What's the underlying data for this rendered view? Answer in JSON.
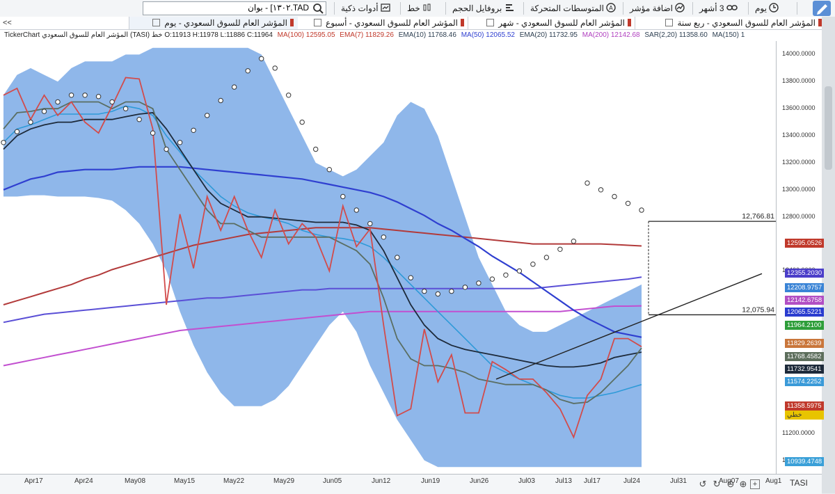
{
  "toolbar": {
    "period": "يوم",
    "range": "3 أشهر",
    "add_indicator": "اضافة مؤشر",
    "moving_averages": "المتوسطات المتحركة",
    "volume_profile": "بروفايل الحجم",
    "line": "خط",
    "smart_tools": "أدوات ذكية",
    "search_value": "TAD.١٣٠٢] - بوان"
  },
  "tabs": [
    {
      "label": "المؤشر العام للسوق السعودي - ربع سنة"
    },
    {
      "label": "المؤشر العام للسوق السعودي - شهر"
    },
    {
      "label": "المؤشر العام للسوق السعودي - أسبوع"
    },
    {
      "label": "المؤشر العام للسوق السعودي - يوم"
    }
  ],
  "tabs_scroll": "<<",
  "infobar": {
    "title": "TickerChart المؤشر العام للسوق السعودي (TASI) خط O:11913 H:11978 L:11886 C:11964",
    "items": [
      {
        "text": "MA(100) 12595.05",
        "color": "#c0392b"
      },
      {
        "text": "EMA(7) 11829.26",
        "color": "#c0392b"
      },
      {
        "text": "EMA(10) 11768.46",
        "color": "#2c3e50"
      },
      {
        "text": "MA(50) 12065.52",
        "color": "#2f3fd0"
      },
      {
        "text": "EMA(20) 11732.95",
        "color": "#2c3e50"
      },
      {
        "text": "MA(200) 12142.68",
        "color": "#b03fbf"
      },
      {
        "text": "SAR(2,20) 11358.60",
        "color": "#2c3e50"
      },
      {
        "text": "MA(150) 1",
        "color": "#2c3e50"
      }
    ]
  },
  "colors": {
    "band": "#1f6fd6",
    "price": "#d24b4b",
    "ema10": "#5a6e62",
    "ema7": "#c97575",
    "ema20": "#1d2a3a",
    "ma50": "#2f3fd0",
    "ma100": "#b23a3a",
    "ma150": "#5a4fd6",
    "ma200": "#c24fd0",
    "fast": "#2e9ad8"
  },
  "chart_data": {
    "type": "line",
    "instrument": "TASI",
    "x_labels": [
      "Apr17",
      "Apr24",
      "May08",
      "May15",
      "May22",
      "May29",
      "Jun05",
      "Jun12",
      "Jun19",
      "Jun26",
      "Jul03",
      "Jul13",
      "Jul17",
      "Jul24",
      "Jul31",
      "Aug07",
      "Aug1"
    ],
    "y_ticks": [
      14000,
      13800,
      13600,
      13400,
      13200,
      13000,
      12800,
      12600,
      12400,
      12200,
      12000,
      11800,
      11600,
      11400,
      11200,
      11000
    ],
    "y_tick_labels": [
      "14000.0000",
      "13800.0000",
      "13600.0000",
      "13400.0000",
      "13200.0000",
      "13000.0000",
      "12800.0000",
      "",
      "12400.0000",
      "",
      "",
      "",
      "",
      "",
      "11200.0000",
      "11000.0000"
    ],
    "ylim": [
      10900,
      14100
    ],
    "annotations": [
      {
        "text": "12,766.81",
        "value": 12766.81
      },
      {
        "text": "12,075.94",
        "value": 12075.94
      }
    ],
    "price_badges": [
      {
        "text": "12595.0526",
        "color": "#c0392b"
      },
      {
        "text": "12355.2030",
        "color": "#4b3ec9"
      },
      {
        "text": "12208.9757",
        "color": "#3a84d6"
      },
      {
        "text": "12142.6758",
        "color": "#b24fc4"
      },
      {
        "text": "12065.5221",
        "color": "#2a3ccf"
      },
      {
        "text": "11964.2100",
        "color": "#2e9e3a"
      },
      {
        "text": "11829.2639",
        "color": "#c9763b"
      },
      {
        "text": "11768.4582",
        "color": "#5d6e5c"
      },
      {
        "text": "11732.9541",
        "color": "#1d2a3a"
      },
      {
        "text": "11574.2252",
        "color": "#3a9ad8"
      },
      {
        "text": "11358.5975",
        "color": "#c0392b"
      },
      {
        "text": "10939.4748",
        "color": "#3aa0d8"
      }
    ],
    "price_badges_partial": "خطي",
    "series": [
      {
        "key": "price",
        "values": [
          13700,
          13750,
          13520,
          13700,
          13550,
          13650,
          13500,
          13420,
          13620,
          13830,
          13820,
          13450,
          12150,
          12820,
          12420,
          12950,
          12700,
          12950,
          12700,
          12500,
          12850,
          12600,
          12750,
          12650,
          12400,
          12880,
          12580,
          12710,
          12000,
          11330,
          11380,
          11970,
          11580,
          11780,
          11350,
          11350,
          11730,
          11670,
          11600,
          11600,
          11500,
          11380,
          11170,
          11480,
          11600,
          11900,
          11900,
          11840
        ]
      },
      {
        "key": "ema10",
        "values": [
          13450,
          13570,
          13580,
          13600,
          13600,
          13650,
          13650,
          13650,
          13600,
          13650,
          13650,
          13600,
          13300,
          13150,
          13000,
          12850,
          12750,
          12750,
          12700,
          12650,
          12650,
          12650,
          12650,
          12650,
          12650,
          12600,
          12550,
          12450,
          12200,
          11900,
          11750,
          11700,
          11700,
          11680,
          11650,
          11600,
          11580,
          11560,
          11560,
          11560,
          11520,
          11450,
          11420,
          11430,
          11500,
          11600,
          11700,
          11830
        ]
      },
      {
        "key": "ema20",
        "values": [
          13300,
          13400,
          13450,
          13480,
          13500,
          13500,
          13520,
          13520,
          13520,
          13540,
          13560,
          13570,
          13450,
          13300,
          13150,
          13000,
          12900,
          12850,
          12800,
          12800,
          12790,
          12780,
          12770,
          12760,
          12760,
          12760,
          12740,
          12700,
          12550,
          12350,
          12150,
          12000,
          11900,
          11850,
          11820,
          11800,
          11780,
          11760,
          11740,
          11720,
          11700,
          11690,
          11690,
          11700,
          11720,
          11760,
          11780,
          11800
        ]
      },
      {
        "key": "fast",
        "values": [
          13350,
          13450,
          13480,
          13520,
          13560,
          13560,
          13560,
          13560,
          13580,
          13620,
          13600,
          13550,
          13400,
          13280,
          13150,
          13050,
          12950,
          12880,
          12830,
          12800,
          12780,
          12750,
          12700,
          12670,
          12650,
          12640,
          12620,
          12580,
          12500,
          12400,
          12300,
          12200,
          12100,
          12000,
          11900,
          11800,
          11700,
          11650,
          11600,
          11560,
          11520,
          11480,
          11460,
          11460,
          11480,
          11500,
          11530,
          11560
        ]
      },
      {
        "key": "ma50",
        "values": [
          13000,
          13040,
          13080,
          13100,
          13130,
          13140,
          13150,
          13150,
          13150,
          13160,
          13170,
          13170,
          13170,
          13170,
          13160,
          13150,
          13140,
          13130,
          13120,
          13110,
          13100,
          13090,
          13080,
          13060,
          13040,
          13020,
          13000,
          12980,
          12950,
          12910,
          12860,
          12810,
          12750,
          12700,
          12640,
          12580,
          12510,
          12450,
          12390,
          12320,
          12250,
          12180,
          12110,
          12050,
          12000,
          11950,
          11930,
          11910
        ]
      },
      {
        "key": "ma100",
        "values": [
          12150,
          12180,
          12210,
          12240,
          12270,
          12300,
          12340,
          12370,
          12410,
          12440,
          12470,
          12500,
          12530,
          12560,
          12590,
          12610,
          12630,
          12650,
          12670,
          12680,
          12690,
          12700,
          12710,
          12720,
          12720,
          12720,
          12720,
          12720,
          12710,
          12700,
          12690,
          12680,
          12670,
          12660,
          12650,
          12640,
          12630,
          12620,
          12610,
          12600,
          12600,
          12600,
          12600,
          12600,
          12600,
          12595,
          12590,
          12585
        ]
      },
      {
        "key": "ma150",
        "values": [
          12020,
          12040,
          12060,
          12080,
          12090,
          12100,
          12110,
          12120,
          12130,
          12140,
          12150,
          12160,
          12170,
          12180,
          12190,
          12200,
          12200,
          12210,
          12220,
          12230,
          12240,
          12250,
          12260,
          12260,
          12270,
          12270,
          12270,
          12270,
          12270,
          12270,
          12270,
          12270,
          12270,
          12270,
          12270,
          12270,
          12270,
          12270,
          12270,
          12270,
          12280,
          12290,
          12300,
          12310,
          12320,
          12330,
          12340,
          12355
        ]
      },
      {
        "key": "ma200",
        "values": [
          11700,
          11720,
          11740,
          11760,
          11780,
          11800,
          11820,
          11840,
          11860,
          11880,
          11900,
          11920,
          11940,
          11960,
          11970,
          11980,
          11990,
          12000,
          12010,
          12020,
          12030,
          12040,
          12050,
          12060,
          12070,
          12080,
          12090,
          12100,
          12100,
          12100,
          12100,
          12100,
          12100,
          12100,
          12100,
          12100,
          12100,
          12100,
          12100,
          12100,
          12100,
          12100,
          12110,
          12120,
          12130,
          12140,
          12140,
          12142
        ]
      },
      {
        "key": "band_upper",
        "values": [
          13700,
          13850,
          13900,
          13850,
          13800,
          13900,
          13950,
          13950,
          13950,
          14000,
          14000,
          14050,
          14050,
          14050,
          14050,
          14050,
          14050,
          14050,
          14050,
          14000,
          13800,
          13600,
          13400,
          13200,
          13150,
          13100,
          13150,
          13250,
          13350,
          13550,
          13650,
          13600,
          13400,
          13100,
          12800,
          12500,
          12300,
          12100,
          12000,
          11950,
          11950,
          12000,
          12050,
          12100,
          12150,
          12200,
          12250,
          12300
        ]
      },
      {
        "key": "band_lower",
        "values": [
          12950,
          12950,
          12960,
          12960,
          12950,
          12950,
          12950,
          12940,
          12920,
          12850,
          12750,
          12600,
          12400,
          12100,
          11850,
          11650,
          11500,
          11400,
          11400,
          11400,
          11450,
          11550,
          11700,
          11850,
          12000,
          12100,
          11950,
          11700,
          11500,
          11300,
          11150,
          11000,
          10950,
          10950,
          10950,
          10950,
          10950,
          10950,
          10950,
          10950,
          10950,
          10950,
          10950,
          10950,
          10950,
          10950,
          10950,
          10950
        ]
      },
      {
        "key": "sar",
        "values": [
          13350,
          13430,
          13500,
          13580,
          13650,
          13700,
          13700,
          13690,
          13650,
          13600,
          13520,
          13420,
          13300,
          13350,
          13440,
          13550,
          13660,
          13760,
          13880,
          13970,
          13900,
          13700,
          13500,
          13300,
          13150,
          12950,
          12850,
          12750,
          12650,
          12500,
          12350,
          12250,
          12230,
          12250,
          12280,
          12310,
          12340,
          12370,
          12400,
          12450,
          12500,
          12560,
          12620,
          13050,
          13000,
          12950,
          12900,
          12850
        ]
      }
    ],
    "trendline": {
      "from": {
        "value": 11600
      },
      "to": {
        "value": 12380
      }
    }
  }
}
